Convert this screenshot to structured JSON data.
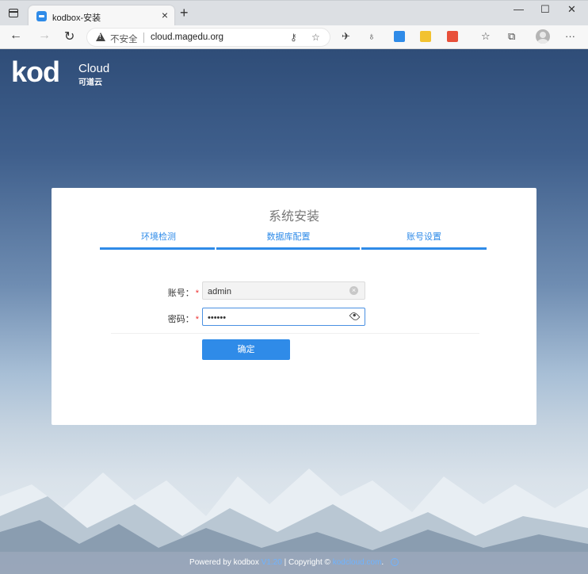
{
  "browser": {
    "tab_title": "kodbox-安装",
    "tab_close": "×",
    "new_tab": "+",
    "window_controls": {
      "minimize": "—",
      "maximize": "☐",
      "close": "✕"
    },
    "nav": {
      "back": "←",
      "forward": "→",
      "refresh": "↻"
    },
    "security_label": "不安全",
    "url": "cloud.magedu.org",
    "toolbar_more": "···"
  },
  "logo": {
    "kod": "kod",
    "cloud": "Cloud",
    "cn": "可道云"
  },
  "install": {
    "title": "系统安装",
    "steps": [
      "环境检测",
      "数据库配置",
      "账号设置"
    ],
    "fields": {
      "account_label": "账号：",
      "account_value": "admin",
      "password_label": "密码：",
      "password_value": "••••••",
      "required_mark": "*"
    },
    "submit_label": "确定"
  },
  "footer": {
    "powered": "Powered by kodbox",
    "version": "V1.20",
    "sep": "|",
    "copyright": "Copyright ©",
    "link": "kodcloud.com",
    "dot": "."
  },
  "colors": {
    "accent": "#2f8be8",
    "required": "#ee3333"
  }
}
